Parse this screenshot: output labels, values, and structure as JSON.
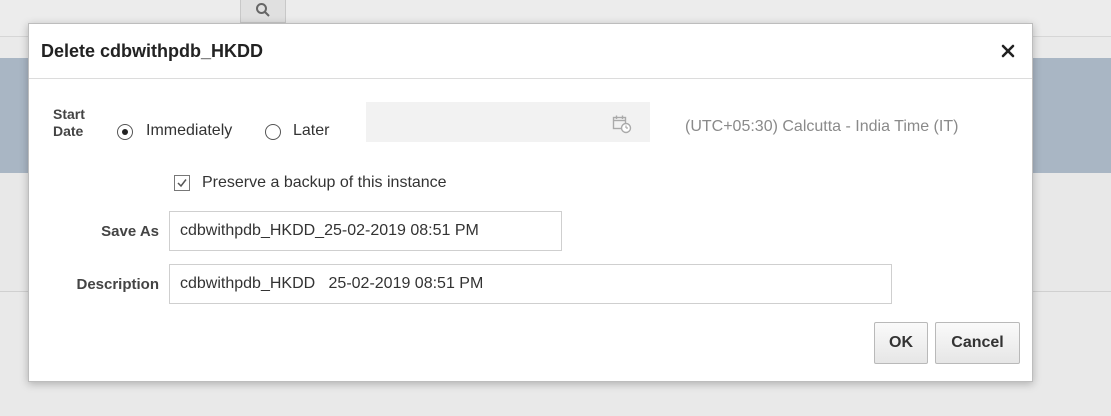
{
  "dialog": {
    "title": "Delete cdbwithpdb_HKDD",
    "close_icon": "close-icon"
  },
  "start_date": {
    "label_line1": "Start",
    "label_line2": "Date",
    "options": [
      {
        "label": "Immediately",
        "selected": true
      },
      {
        "label": "Later",
        "selected": false
      }
    ],
    "date_value": "",
    "calendar_icon": "calendar-icon",
    "timezone": "(UTC+05:30) Calcutta - India Time (IT)"
  },
  "backup": {
    "label": "Preserve a backup of this instance",
    "checked": true
  },
  "save_as": {
    "label": "Save As",
    "value": "cdbwithpdb_HKDD_25-02-2019 08:51 PM"
  },
  "description": {
    "label": "Description",
    "value": "cdbwithpdb_HKDD   25-02-2019 08:51 PM"
  },
  "buttons": {
    "ok": "OK",
    "cancel": "Cancel"
  },
  "background": {
    "search_icon": "search-icon"
  },
  "colors": {
    "overlay_band": "#a9b6c4",
    "dialog_bg": "#ffffff",
    "timezone_text": "#8a8a8a"
  }
}
